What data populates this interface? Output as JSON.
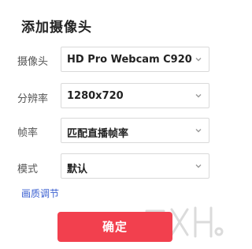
{
  "dialog": {
    "title": "添加摄像头",
    "fields": [
      {
        "label": "摄像头",
        "value": "HD Pro Webcam C920"
      },
      {
        "label": "分辨率",
        "value": "1280x720"
      },
      {
        "label": "帧率",
        "value": "匹配直播帧率"
      },
      {
        "label": "模式",
        "value": "默认"
      }
    ],
    "image_adjust_link": "画质调节",
    "confirm_label": "确定"
  },
  "colors": {
    "accent": "#f2404e",
    "link": "#3a5fd0",
    "border": "#d9d9d9"
  },
  "icons": {
    "dropdown": "chevron-down-icon"
  }
}
